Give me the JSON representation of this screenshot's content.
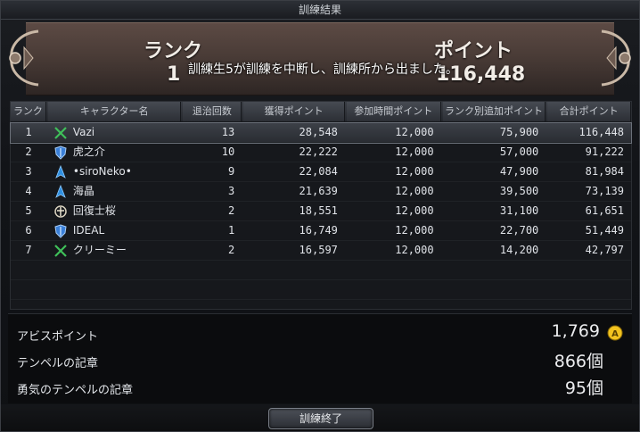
{
  "window": {
    "title": "訓練結果"
  },
  "banner": {
    "rank_label": "ランク",
    "rank_value": "1",
    "points_label": "ポイント",
    "points_value": "116,448",
    "notice": "訓練生5が訓練を中断し、訓練所から出ました。"
  },
  "table": {
    "columns": [
      "ランク",
      "キャラクター名",
      "退治回数",
      "獲得ポイント",
      "参加時間ポイント",
      "ランク別追加ポイント",
      "合計ポイント"
    ],
    "rows": [
      {
        "rank": "1",
        "class_icon": "sword-cross-icon",
        "name": "Vazi",
        "subdue": "13",
        "earned": "28,548",
        "time": "12,000",
        "bonus": "75,900",
        "total": "116,448"
      },
      {
        "rank": "2",
        "class_icon": "shield-icon",
        "name": "虎之介",
        "subdue": "10",
        "earned": "22,222",
        "time": "12,000",
        "bonus": "57,000",
        "total": "91,222"
      },
      {
        "rank": "3",
        "class_icon": "mage-icon",
        "name": "•siroNeko•",
        "subdue": "9",
        "earned": "22,084",
        "time": "12,000",
        "bonus": "47,900",
        "total": "81,984"
      },
      {
        "rank": "4",
        "class_icon": "mage-icon",
        "name": "海晶",
        "subdue": "3",
        "earned": "21,639",
        "time": "12,000",
        "bonus": "39,500",
        "total": "73,139"
      },
      {
        "rank": "5",
        "class_icon": "cleric-icon",
        "name": "回復士桜",
        "subdue": "2",
        "earned": "18,551",
        "time": "12,000",
        "bonus": "31,100",
        "total": "61,651"
      },
      {
        "rank": "6",
        "class_icon": "shield-icon",
        "name": "IDEAL",
        "subdue": "1",
        "earned": "16,749",
        "time": "12,000",
        "bonus": "22,700",
        "total": "51,449"
      },
      {
        "rank": "7",
        "class_icon": "sword-cross-icon",
        "name": "クリーミー",
        "subdue": "2",
        "earned": "16,597",
        "time": "12,000",
        "bonus": "14,200",
        "total": "42,797"
      }
    ]
  },
  "stats": {
    "abyss_label": "アビスポイント",
    "abyss_value": "1,769",
    "temple_label": "テンペルの記章",
    "temple_value": "866個",
    "courage_label": "勇気のテンペルの記章",
    "courage_value": "95個"
  },
  "footer": {
    "end_button": "訓練終了"
  },
  "colors": {
    "banner": "#4a3c37",
    "abyss_badge": "#f2c31f",
    "selected_row": "#3c4048"
  }
}
